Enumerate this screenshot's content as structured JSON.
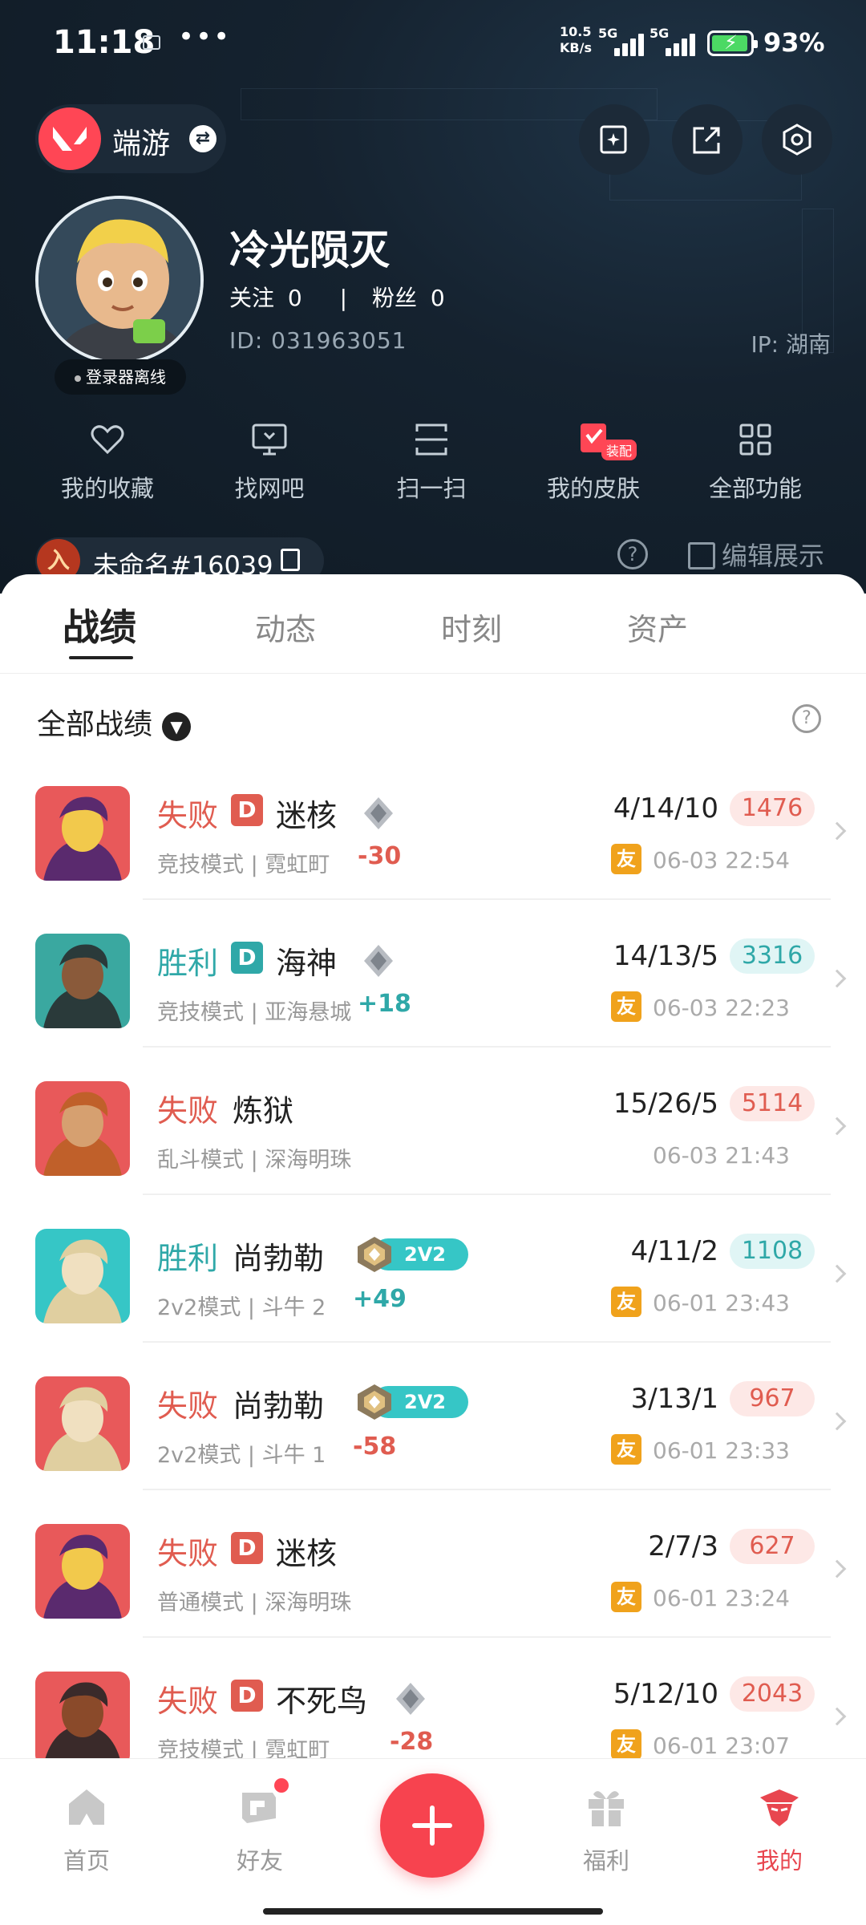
{
  "status_bar": {
    "time": "11:18",
    "net_speed_line1": "10.5",
    "net_speed_line2": "KB/s",
    "signal1": "5G",
    "signal2": "5G",
    "battery_pct": "93%"
  },
  "header": {
    "mode_label": "端游",
    "nickname": "冷光陨灭",
    "follow_label": "关注",
    "follow_count": "0",
    "fans_label": "粉丝",
    "fans_count": "0",
    "uid": "ID: 031963051",
    "ip": "IP: 湖南",
    "offline_status": "登录器离线"
  },
  "quick_actions": [
    {
      "label": "我的收藏",
      "icon": "heart-icon"
    },
    {
      "label": "找网吧",
      "icon": "monitor-icon"
    },
    {
      "label": "扫一扫",
      "icon": "scan-icon"
    },
    {
      "label": "我的皮肤",
      "icon": "skin-icon",
      "badge": "装配"
    },
    {
      "label": "全部功能",
      "icon": "grid-icon"
    }
  ],
  "game_account": {
    "name": "未命名#16039",
    "emblem_char": "入"
  },
  "edit_label": "编辑展示",
  "tabs": [
    "战绩",
    "动态",
    "时刻",
    "资产"
  ],
  "filter_label": "全部战绩",
  "matches": [
    {
      "result": "失败",
      "outcome": "loss",
      "tag": "D",
      "agent": "迷核",
      "mode": "竞技模式 | 霓虹町",
      "delta": "-30",
      "kda": "4/14/10",
      "score": "1476",
      "friend": "友",
      "time": "06-03 22:54",
      "rank": "diamond"
    },
    {
      "result": "胜利",
      "outcome": "win",
      "tag": "D",
      "agent": "海神",
      "mode": "竞技模式 | 亚海悬城",
      "delta": "+18",
      "kda": "14/13/5",
      "score": "3316",
      "friend": "友",
      "time": "06-03 22:23",
      "rank": "diamond"
    },
    {
      "result": "失败",
      "outcome": "loss",
      "tag": "",
      "agent": "炼狱",
      "mode": "乱斗模式 | 深海明珠",
      "delta": "",
      "kda": "15/26/5",
      "score": "5114",
      "friend": "",
      "time": "06-03 21:43",
      "rank": ""
    },
    {
      "result": "胜利",
      "outcome": "win",
      "tag": "",
      "agent": "尚勃勒",
      "mode": "2v2模式 | 斗牛 2",
      "delta": "+49",
      "kda": "4/11/2",
      "score": "1108",
      "friend": "友",
      "time": "06-01 23:43",
      "rank": "2v2",
      "badge_text": "2V2"
    },
    {
      "result": "失败",
      "outcome": "loss",
      "tag": "",
      "agent": "尚勃勒",
      "mode": "2v2模式 | 斗牛 1",
      "delta": "-58",
      "kda": "3/13/1",
      "score": "967",
      "friend": "友",
      "time": "06-01 23:33",
      "rank": "2v2",
      "badge_text": "2V2"
    },
    {
      "result": "失败",
      "outcome": "loss",
      "tag": "D",
      "agent": "迷核",
      "mode": "普通模式 | 深海明珠",
      "delta": "",
      "kda": "2/7/3",
      "score": "627",
      "friend": "友",
      "time": "06-01 23:24",
      "rank": ""
    },
    {
      "result": "失败",
      "outcome": "loss",
      "tag": "D",
      "agent": "不死鸟",
      "mode": "竞技模式 | 霓虹町",
      "delta": "-28",
      "kda": "5/12/10",
      "score": "2043",
      "friend": "友",
      "time": "06-01 23:07",
      "rank": "diamond"
    }
  ],
  "bottom_nav": [
    {
      "label": "首页"
    },
    {
      "label": "好友"
    },
    {
      "label": "福利"
    },
    {
      "label": "我的"
    }
  ],
  "colors": {
    "accent": "#ff4655",
    "loss": "#e05c50",
    "win": "#2fa8a8",
    "friend_tag": "#f0a21c"
  }
}
